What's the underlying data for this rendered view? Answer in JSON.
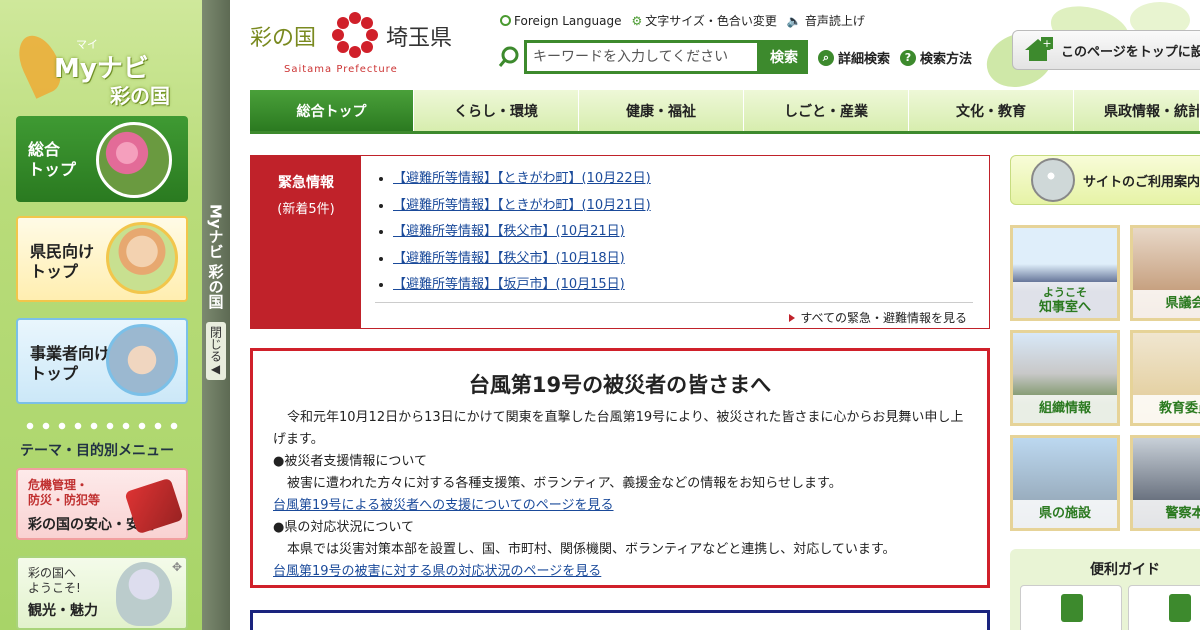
{
  "sidebar": {
    "logo": {
      "ruby": "マイ",
      "line1": "Myナビ",
      "line2": "彩の国"
    },
    "tab_title": "Myナビ 彩の国",
    "tab_close": "閉じる◀",
    "buttons": {
      "top": "総合\nトップ",
      "citizen": "県民向け\nトップ",
      "business": "事業者向け\nトップ"
    },
    "theme_title": "テーマ・目的別メニュー",
    "safety": {
      "sub": "危機管理・\n防災・防犯等",
      "main": "彩の国の安心・安全"
    },
    "tourism": {
      "sub": "彩の国へ\nようこそ!",
      "main": "観光・魅力"
    }
  },
  "header": {
    "logo_left": "彩の国",
    "logo_right": "埼玉県",
    "logo_en": "Saitama Prefecture",
    "util": {
      "foreign": "Foreign Language",
      "textsize": "文字サイズ・色合い変更",
      "voice": "音声読上げ"
    },
    "search": {
      "placeholder": "キーワードを入力してください",
      "button": "検索"
    },
    "adv_search": "詳細検索",
    "search_help": "検索方法",
    "set_top": "このページをトップに設"
  },
  "nav": [
    {
      "label": "総合トップ",
      "active": true
    },
    {
      "label": "くらし・環境"
    },
    {
      "label": "健康・福祉"
    },
    {
      "label": "しごと・産業"
    },
    {
      "label": "文化・教育"
    },
    {
      "label": "県政情報・統計"
    }
  ],
  "emergency": {
    "title": "緊急情報",
    "subtitle": "(新着5件)",
    "items": [
      "【避難所等情報】【ときがわ町】(10月22日)",
      "【避難所等情報】【ときがわ町】(10月21日)",
      "【避難所等情報】【秩父市】(10月21日)",
      "【避難所等情報】【秩父市】(10月18日)",
      "【避難所等情報】【坂戸市】(10月15日)"
    ],
    "more": "すべての緊急・避難情報を見る"
  },
  "notice": {
    "title": "台風第19号の被災者の皆さまへ",
    "intro": "令和元年10月12日から13日にかけて関東を直撃した台風第19号により、被災された皆さまに心からお見舞い申し上げます。",
    "sec1_head": "●被災者支援情報について",
    "sec1_body": "被害に遭われた方々に対する各種支援策、ボランティア、義援金などの情報をお知らせします。",
    "sec1_link": "台風第19号による被災者への支援についてのページを見る",
    "sec2_head": "●県の対応状況について",
    "sec2_body": "本県では災害対策本部を設置し、国、市町村、関係機関、ボランティアなどと連携し、対応しています。",
    "sec2_link": "台風第19号の被害に対する県の対応状況のページを見る"
  },
  "right": {
    "guide": "サイトのご利用案内",
    "cards": {
      "governor_sub": "ようこそ",
      "governor": "知事室へ",
      "assembly": "県議会",
      "org": "組織情報",
      "education": "教育委員",
      "facilities": "県の施設",
      "police": "警察本"
    },
    "handy": "便利ガイド"
  }
}
